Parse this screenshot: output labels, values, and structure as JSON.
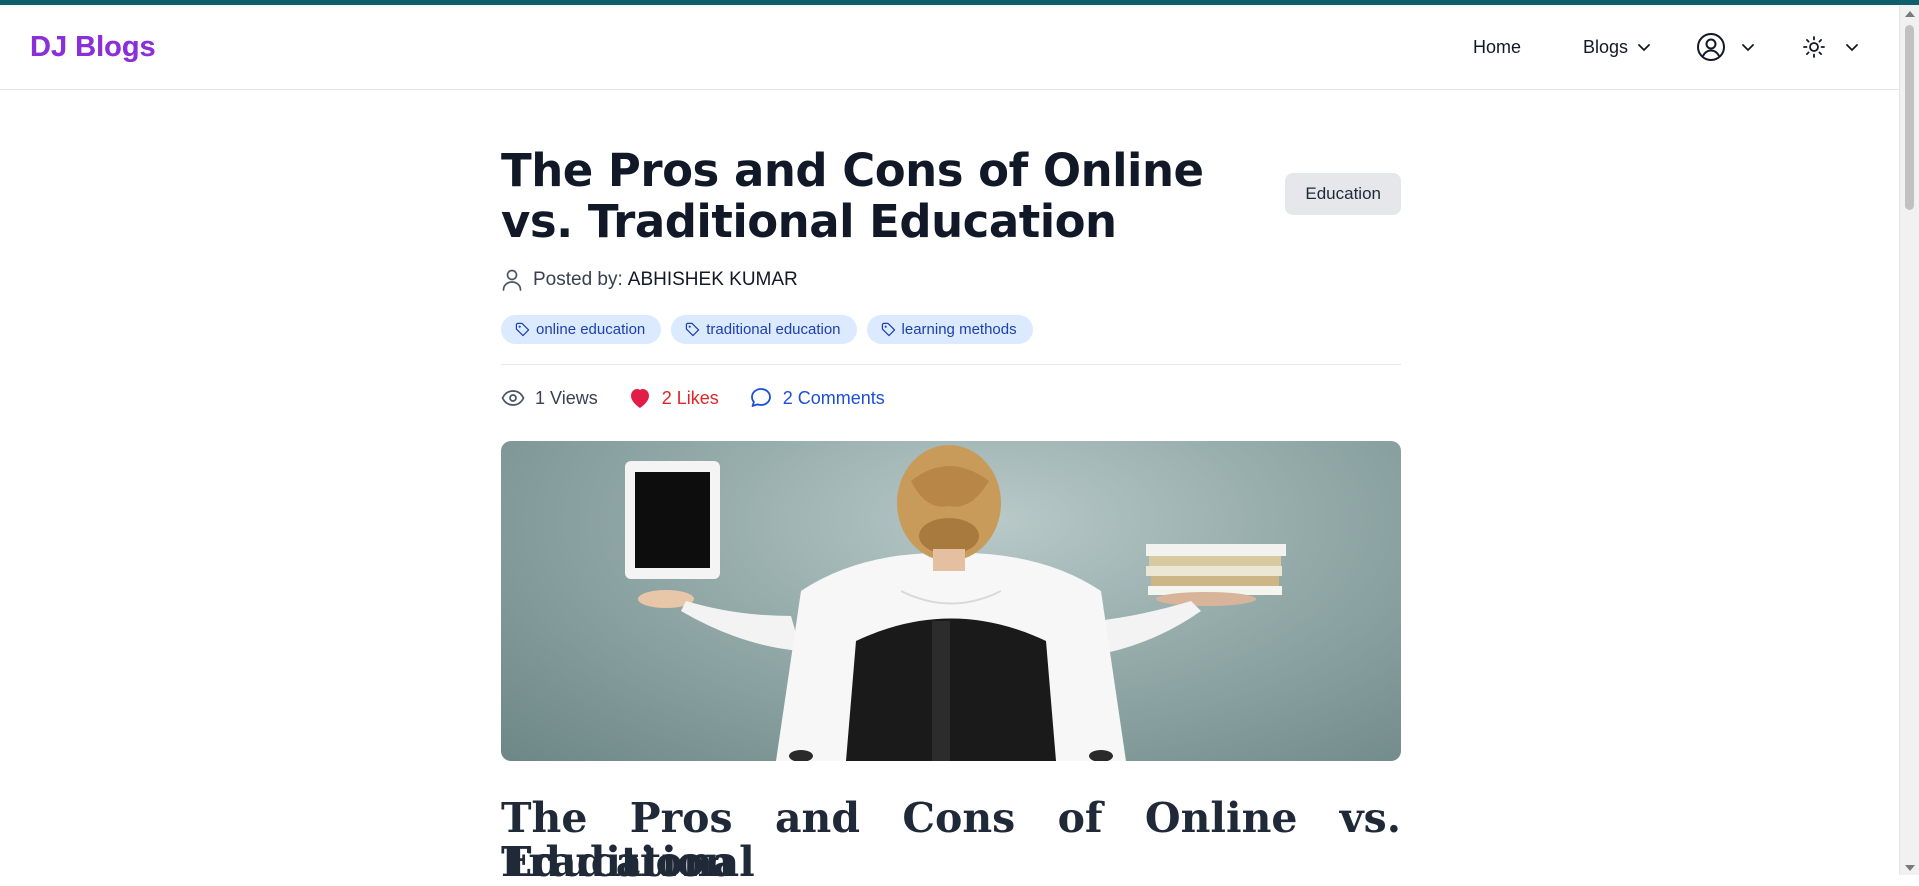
{
  "app": {
    "brand": "DJ Blogs"
  },
  "nav": {
    "home": "Home",
    "blogs": "Blogs"
  },
  "icons": {
    "user": "user-circle-icon",
    "theme": "sun-icon",
    "chevron": "chevron-down-icon",
    "author": "person-icon",
    "tag": "tag-icon",
    "views": "eye-icon",
    "likes": "heart-icon",
    "comments": "comment-icon"
  },
  "article": {
    "title": "The Pros and Cons of Online vs. Traditional Education",
    "category": "Education",
    "posted_by_label": "Posted by:",
    "author": "ABHISHEK KUMAR",
    "tags": [
      "online education",
      "traditional education",
      "learning methods"
    ],
    "stats": {
      "views": "1 Views",
      "likes": "2 Likes",
      "comments": "2 Comments"
    },
    "content_heading_line1": "The Pros and Cons of Online vs. Traditional",
    "content_heading_line2": "Education"
  },
  "colors": {
    "accent_bar": "#0f5e6b",
    "brand": "#8b2fd9",
    "likes": "#dc2626",
    "comments": "#1d4ed8",
    "tag_bg": "#dbeafe"
  }
}
